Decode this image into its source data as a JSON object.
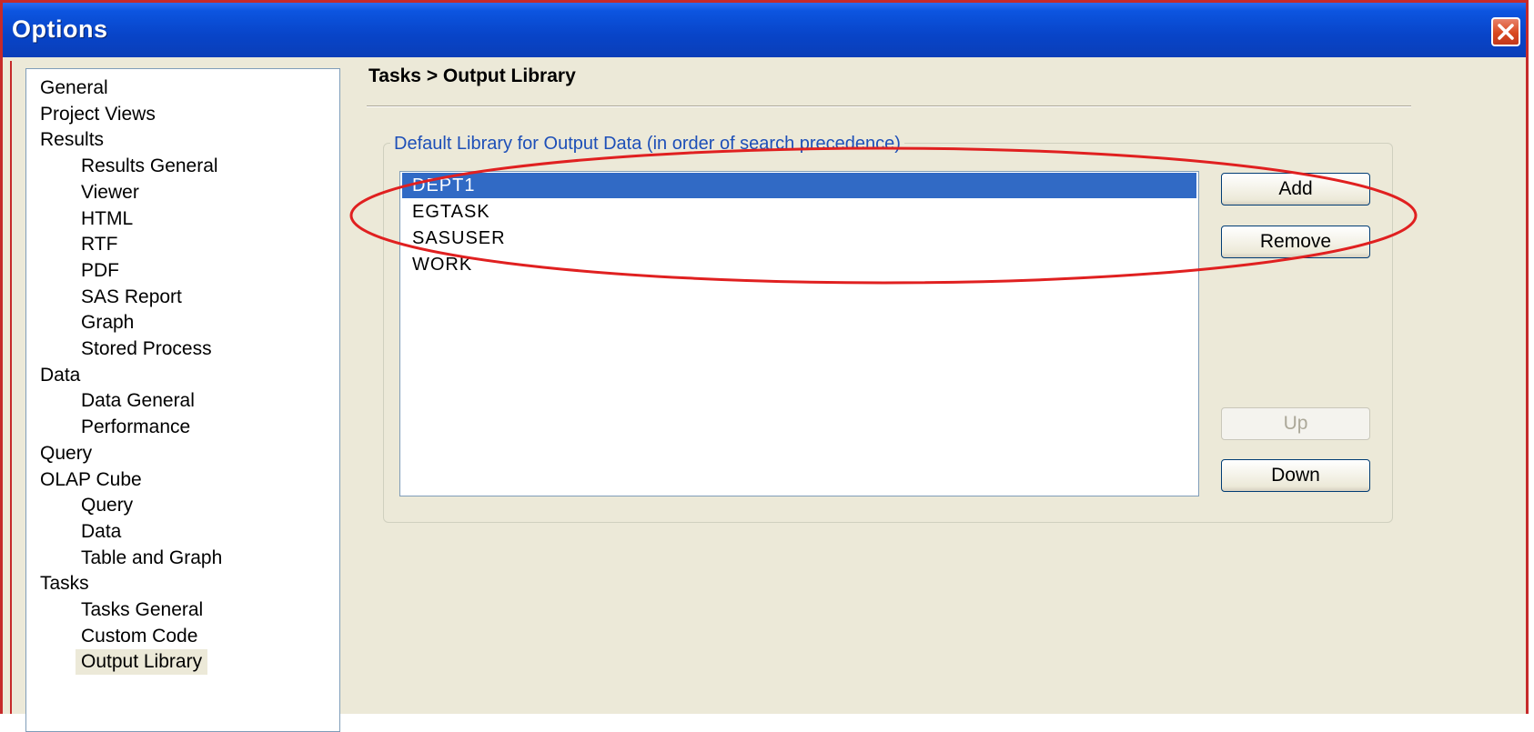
{
  "window": {
    "title": "Options"
  },
  "tree": {
    "items": [
      {
        "label": "General",
        "level": 1
      },
      {
        "label": "Project Views",
        "level": 1
      },
      {
        "label": "Results",
        "level": 1
      },
      {
        "label": "Results General",
        "level": 2
      },
      {
        "label": "Viewer",
        "level": 2
      },
      {
        "label": "HTML",
        "level": 2
      },
      {
        "label": "RTF",
        "level": 2
      },
      {
        "label": "PDF",
        "level": 2
      },
      {
        "label": "SAS Report",
        "level": 2
      },
      {
        "label": "Graph",
        "level": 2
      },
      {
        "label": "Stored Process",
        "level": 2
      },
      {
        "label": "Data",
        "level": 1
      },
      {
        "label": "Data General",
        "level": 2
      },
      {
        "label": "Performance",
        "level": 2
      },
      {
        "label": "Query",
        "level": 1
      },
      {
        "label": "OLAP Cube",
        "level": 1
      },
      {
        "label": "Query",
        "level": 2
      },
      {
        "label": "Data",
        "level": 2
      },
      {
        "label": "Table and Graph",
        "level": 2
      },
      {
        "label": "Tasks",
        "level": 1
      },
      {
        "label": "Tasks General",
        "level": 2
      },
      {
        "label": "Custom Code",
        "level": 2
      },
      {
        "label": "Output Library",
        "level": 2,
        "selected": true
      }
    ]
  },
  "panel": {
    "breadcrumb": "Tasks > Output Library",
    "group_label": "Default Library for Output Data (in order of search precedence)",
    "libraries": [
      "DEPT1",
      "EGTASK",
      "SASUSER",
      "WORK"
    ],
    "selected_library": "DEPT1",
    "buttons": {
      "add": "Add",
      "remove": "Remove",
      "up": "Up",
      "down": "Down"
    }
  },
  "colors": {
    "title_bar": "#0a4bd0",
    "selection": "#316ac5",
    "annotation": "#e02020"
  }
}
